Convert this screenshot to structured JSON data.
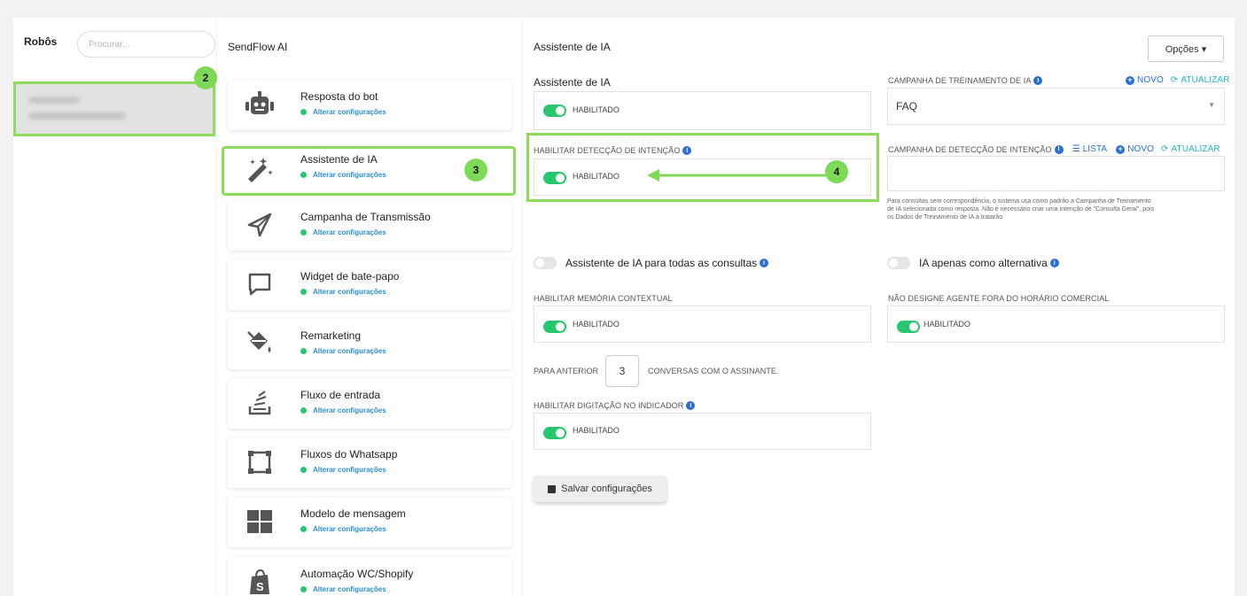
{
  "bots": {
    "title": "Robôs",
    "search_placeholder": "Procurar..."
  },
  "steps": {
    "s2": "2",
    "s3": "3",
    "s4": "4"
  },
  "menu": {
    "title": "SendFlow AI",
    "status_label": "Alterar configurações",
    "items": [
      {
        "label": "Resposta do bot",
        "icon": "robot-icon"
      },
      {
        "label": "Assistente de IA",
        "icon": "magic-wand-icon"
      },
      {
        "label": "Campanha de Transmissão",
        "icon": "paper-plane-icon"
      },
      {
        "label": "Widget de bate-papo",
        "icon": "chat-bubble-icon"
      },
      {
        "label": "Remarketing",
        "icon": "paint-bucket-icon"
      },
      {
        "label": "Fluxo de entrada",
        "icon": "stack-icon"
      },
      {
        "label": "Fluxos do Whatsapp",
        "icon": "frame-icon"
      },
      {
        "label": "Modelo de mensagem",
        "icon": "grid-icon"
      },
      {
        "label": "Automação WC/Shopify",
        "icon": "shopify-bag-icon"
      }
    ]
  },
  "main": {
    "title": "Assistente de IA",
    "options_label": "Opções ▾",
    "ai_assistant": {
      "label": "Assistente de IA",
      "toggle_text": "HABILITADO"
    },
    "training_campaign": {
      "label": "CAMPANHA DE TREINAMENTO DE IA",
      "new_label": "NOVO",
      "refresh_label": "ATUALIZAR",
      "selected": "FAQ"
    },
    "intent_detection": {
      "label": "HABILITAR DETECÇÃO DE INTENÇÃO",
      "toggle_text": "HABILITADO"
    },
    "intent_campaign": {
      "label": "CAMPANHA DE DETECÇÃO DE INTENÇÃO",
      "list_label": "LISTA",
      "new_label": "NOVO",
      "refresh_label": "ATUALIZAR",
      "help_line1": "Para consultas sem correspondência, o sistema usa como padrão a Campanha de Treinamento",
      "help_line2": "de IA selecionada como resposta. Não é necessário criar uma intenção de \"Consulta Geral\", pois",
      "help_line3": "os Dados de Treinamento de IA a tratarão."
    },
    "all_queries": {
      "label": "Assistente de IA para todas as consultas"
    },
    "fallback_only": {
      "label": "IA apenas como alternativa"
    },
    "context_memory": {
      "label": "HABILITAR MEMÓRIA CONTEXTUAL",
      "toggle_text": "HABILITADO"
    },
    "no_agent": {
      "label": "NÃO DESIGNE AGENTE FORA DO HORÁRIO COMERCIAL",
      "toggle_text": "HABILITADO"
    },
    "previous": {
      "prefix": "PARA ANTERIOR",
      "value": "3",
      "suffix": "CONVERSAS COM O ASSINANTE."
    },
    "typing_indicator": {
      "label": "HABILITAR DIGITAÇÃO NO INDICADOR",
      "toggle_text": "HABILITADO"
    },
    "save_label": "Salvar configurações"
  },
  "colors": {
    "accent_green": "#28c76f",
    "highlight": "#8bdc5a",
    "link_blue": "#2b6fd6",
    "link_teal": "#23b5c5"
  }
}
